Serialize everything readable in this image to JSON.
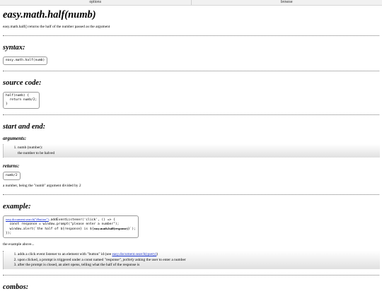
{
  "topbar": {
    "options_label": "options",
    "browse_label": "browse"
  },
  "page": {
    "title": "easy.math.half(numb)",
    "description": "easy.math.half() returns the half of the number passed as the argument"
  },
  "syntax": {
    "heading": "syntax:",
    "code": "easy.math.half(numb)"
  },
  "source": {
    "heading": "source code:",
    "code": "half(numb) {\n  return numb/2;\n}"
  },
  "start_end": {
    "heading": "start and end:",
    "arguments_heading": "arguments:",
    "argument_name": "numb (number):",
    "argument_desc": "the number to be halved",
    "returns_heading": "returns:",
    "returns_code": "numb/2",
    "returns_desc": "a number, being the \"numb\" argument divided by 2"
  },
  "example": {
    "heading": "example:",
    "code_link": "easy.document.search(\"#button\")",
    "code_line1_rest": ".addEventListener('click', () => {",
    "code_line2": "  const response = window.prompt(\"please enter a number\");",
    "code_line3_pre": "  window.alert(`the half of ${response} is ${",
    "code_line3_bold": "easy.math.half(response)",
    "code_line3_post": "}`);",
    "code_line4": "});",
    "intro": "the example above...",
    "steps": {
      "s1_pre": "adds a click event listener to an element with \"button\" id (see ",
      "s1_link": "easy.document.search(query)",
      "s1_post": ")",
      "s2_pre": "upon clicked, a prompt is triggered under a const named \"response\", ",
      "s2_italic": "politely",
      "s2_post": " asking the user to enter a number",
      "s3": "after the prompt is closed, an alert opens, telling what the half of the response is"
    }
  },
  "combos": {
    "heading": "combos:"
  }
}
